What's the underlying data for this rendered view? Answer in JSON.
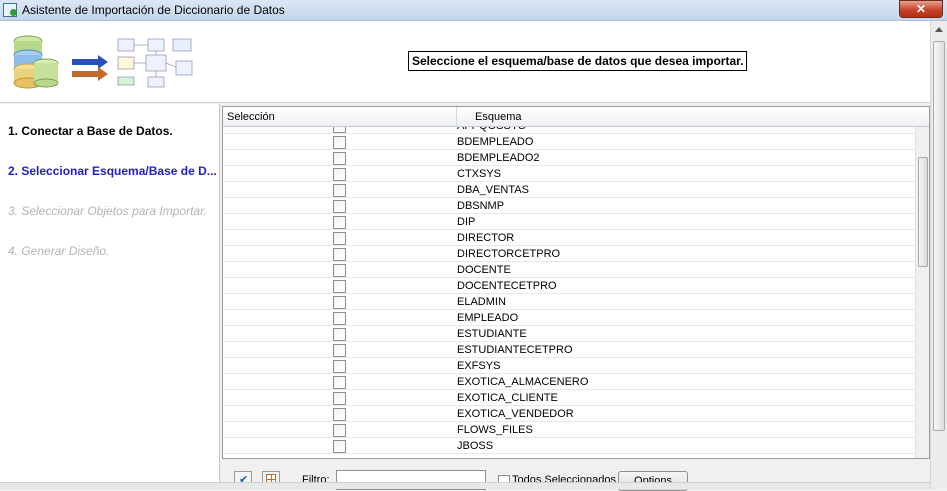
{
  "window": {
    "title": "Asistente de Importación de Diccionario de Datos",
    "close_label": "✕"
  },
  "header": {
    "instruction": "Seleccione el esquema/base de datos que desea importar."
  },
  "steps": [
    {
      "label": "1. Conectar a Base de Datos."
    },
    {
      "label": "2. Seleccionar Esquema/Base de D..."
    },
    {
      "label": "3. Seleccionar Objetos para Importar."
    },
    {
      "label": "4. Generar Diseño."
    }
  ],
  "grid": {
    "columns": [
      "Selección",
      "Esquema"
    ],
    "rows": [
      {
        "name": "APPQOSSYS",
        "checked": false
      },
      {
        "name": "BDEMPLEADO",
        "checked": false
      },
      {
        "name": "BDEMPLEADO2",
        "checked": false
      },
      {
        "name": "CTXSYS",
        "checked": false
      },
      {
        "name": "DBA_VENTAS",
        "checked": false
      },
      {
        "name": "DBSNMP",
        "checked": false
      },
      {
        "name": "DIP",
        "checked": false
      },
      {
        "name": "DIRECTOR",
        "checked": false
      },
      {
        "name": "DIRECTORCETPRO",
        "checked": false
      },
      {
        "name": "DOCENTE",
        "checked": false
      },
      {
        "name": "DOCENTECETPRO",
        "checked": false
      },
      {
        "name": "ELADMIN",
        "checked": false
      },
      {
        "name": "EMPLEADO",
        "checked": false
      },
      {
        "name": "ESTUDIANTE",
        "checked": false
      },
      {
        "name": "ESTUDIANTECETPRO",
        "checked": false
      },
      {
        "name": "EXFSYS",
        "checked": false
      },
      {
        "name": "EXOTICA_ALMACENERO",
        "checked": false
      },
      {
        "name": "EXOTICA_CLIENTE",
        "checked": false
      },
      {
        "name": "EXOTICA_VENDEDOR",
        "checked": false
      },
      {
        "name": "FLOWS_FILES",
        "checked": false
      },
      {
        "name": "JBOSS",
        "checked": false
      }
    ]
  },
  "footer": {
    "filter_label": "Filtro:",
    "filter_value": "",
    "select_all_label": "Todos Seleccionados",
    "options_label": "Options"
  }
}
